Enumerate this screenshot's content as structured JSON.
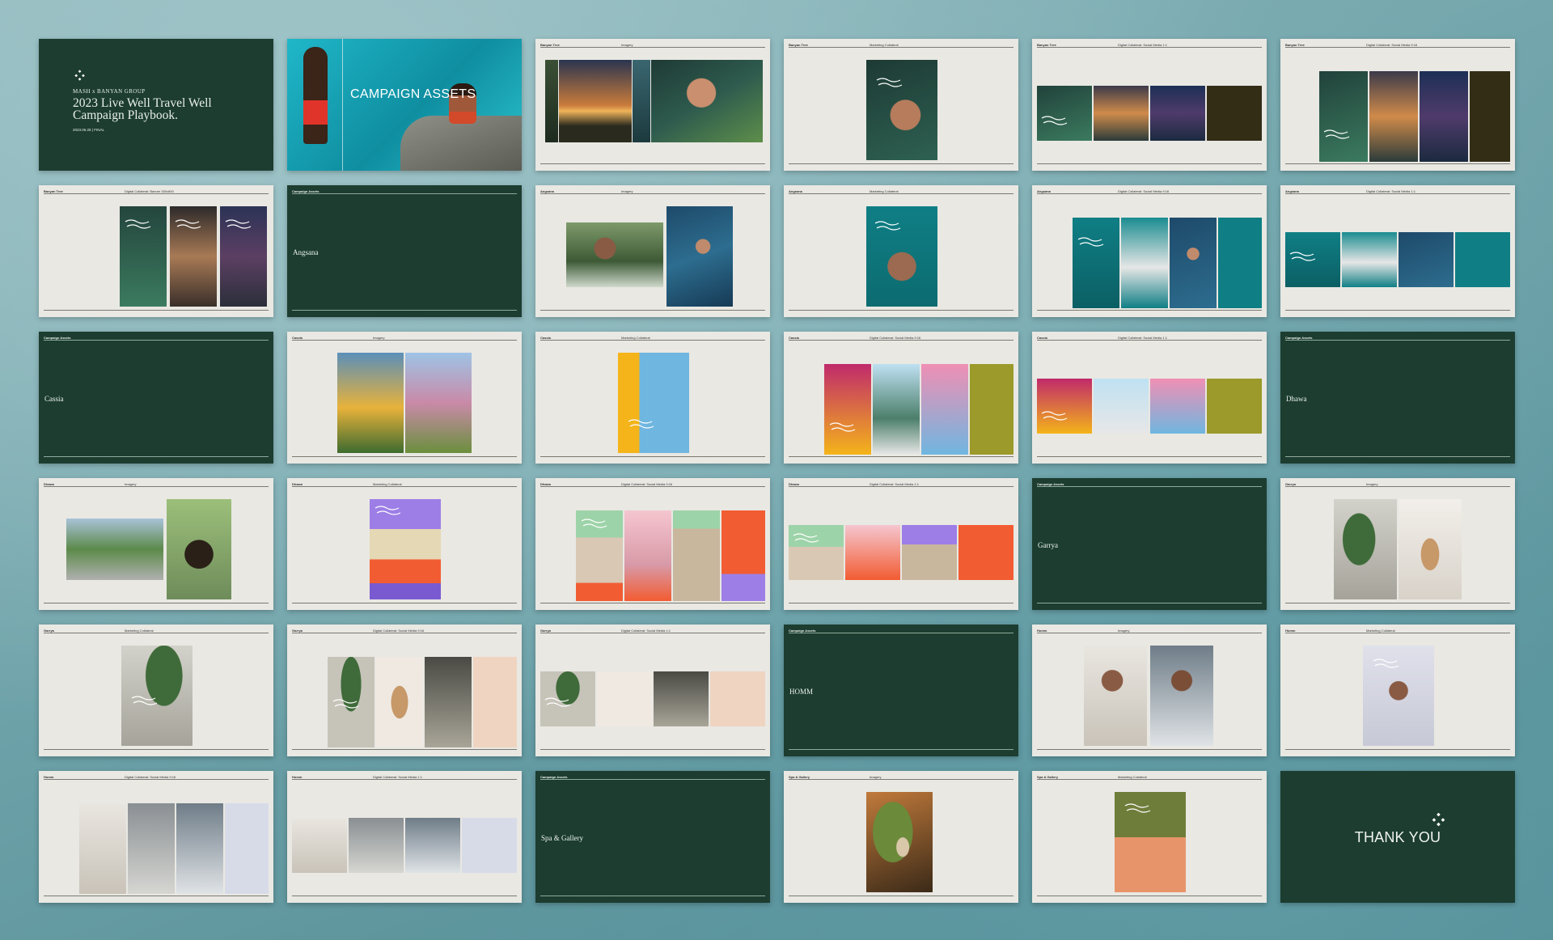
{
  "cover": {
    "brand": "MASH x BANYAN GROUP",
    "title": "2023 Live Well Travel Well Campaign Playbook.",
    "date": "2023.06.28 | FINAL"
  },
  "assets_title": "CAMPAIGN ASSETS",
  "thank_you": "THANK YOU",
  "logo_letters": [
    "M",
    "A",
    "S",
    "H"
  ],
  "colors": {
    "forest": "#1c3d30",
    "paper": "#e9e8e3",
    "teal": "#0f8ea0"
  },
  "slides": [
    {
      "kind": "cover"
    },
    {
      "kind": "assets"
    },
    {
      "kind": "content",
      "brand": "Banyan Tree",
      "section": "Imagery",
      "variant": "banyan-imagery"
    },
    {
      "kind": "content",
      "brand": "Banyan Tree",
      "section": "Marketing Collateral",
      "variant": "banyan-collateral"
    },
    {
      "kind": "content",
      "brand": "Banyan Tree",
      "section": "Digital Collateral: Social Media 1:1",
      "variant": "banyan-social-11"
    },
    {
      "kind": "content",
      "brand": "Banyan Tree",
      "section": "Digital Collateral: Social Media 9:16",
      "variant": "banyan-social-916"
    },
    {
      "kind": "content",
      "brand": "Banyan Tree",
      "section": "Digital Collateral: Banner 300x600",
      "variant": "banyan-banner"
    },
    {
      "kind": "divider",
      "label": "Campaign Assets",
      "name": "Angsana"
    },
    {
      "kind": "content",
      "brand": "Angsana",
      "section": "Imagery",
      "variant": "angsana-imagery"
    },
    {
      "kind": "content",
      "brand": "Angsana",
      "section": "Marketing Collateral",
      "variant": "angsana-collateral"
    },
    {
      "kind": "content",
      "brand": "Angsana",
      "section": "Digital Collateral: Social Media 9:16",
      "variant": "angsana-social-916"
    },
    {
      "kind": "content",
      "brand": "Angsana",
      "section": "Digital Collateral: Social Media 1:1",
      "variant": "angsana-social-11"
    },
    {
      "kind": "divider",
      "label": "Campaign Assets",
      "name": "Cassia"
    },
    {
      "kind": "content",
      "brand": "Cassia",
      "section": "Imagery",
      "variant": "cassia-imagery"
    },
    {
      "kind": "content",
      "brand": "Cassia",
      "section": "Marketing Collateral",
      "variant": "cassia-collateral"
    },
    {
      "kind": "content",
      "brand": "Cassia",
      "section": "Digital Collateral: Social Media 9:16",
      "variant": "cassia-social-916"
    },
    {
      "kind": "content",
      "brand": "Cassia",
      "section": "Digital Collateral: Social Media 1:1",
      "variant": "cassia-social-11"
    },
    {
      "kind": "divider",
      "label": "Campaign Assets",
      "name": "Dhawa"
    },
    {
      "kind": "content",
      "brand": "Dhawa",
      "section": "Imagery",
      "variant": "dhawa-imagery"
    },
    {
      "kind": "content",
      "brand": "Dhawa",
      "section": "Marketing Collateral",
      "variant": "dhawa-collateral"
    },
    {
      "kind": "content",
      "brand": "Dhawa",
      "section": "Digital Collateral: Social Media 9:16",
      "variant": "dhawa-social-916"
    },
    {
      "kind": "content",
      "brand": "Dhawa",
      "section": "Digital Collateral: Social Media 1:1",
      "variant": "dhawa-social-11"
    },
    {
      "kind": "divider",
      "label": "Campaign Assets",
      "name": "Garrya"
    },
    {
      "kind": "content",
      "brand": "Garrya",
      "section": "Imagery",
      "variant": "garrya-imagery"
    },
    {
      "kind": "content",
      "brand": "Garrya",
      "section": "Marketing Collateral",
      "variant": "garrya-collateral"
    },
    {
      "kind": "content",
      "brand": "Garrya",
      "section": "Digital Collateral: Social Media 9:16",
      "variant": "garrya-social-916"
    },
    {
      "kind": "content",
      "brand": "Garrya",
      "section": "Digital Collateral: Social Media 1:1",
      "variant": "garrya-social-11"
    },
    {
      "kind": "divider",
      "label": "Campaign Assets",
      "name": "HOMM"
    },
    {
      "kind": "content",
      "brand": "Homm",
      "section": "Imagery",
      "variant": "homm-imagery"
    },
    {
      "kind": "content",
      "brand": "Homm",
      "section": "Marketing Collateral",
      "variant": "homm-collateral"
    },
    {
      "kind": "content",
      "brand": "Homm",
      "section": "Digital Collateral: Social Media 9:16",
      "variant": "homm-social-916"
    },
    {
      "kind": "content",
      "brand": "Homm",
      "section": "Digital Collateral: Social Media 1:1",
      "variant": "homm-social-11"
    },
    {
      "kind": "divider",
      "label": "Campaign Assets",
      "name": "Spa & Gallery"
    },
    {
      "kind": "content",
      "brand": "Spa & Gallery",
      "section": "Imagery",
      "variant": "spa-imagery"
    },
    {
      "kind": "content",
      "brand": "Spa & Gallery",
      "section": "Marketing Collateral",
      "variant": "spa-collateral"
    },
    {
      "kind": "thankyou"
    }
  ]
}
